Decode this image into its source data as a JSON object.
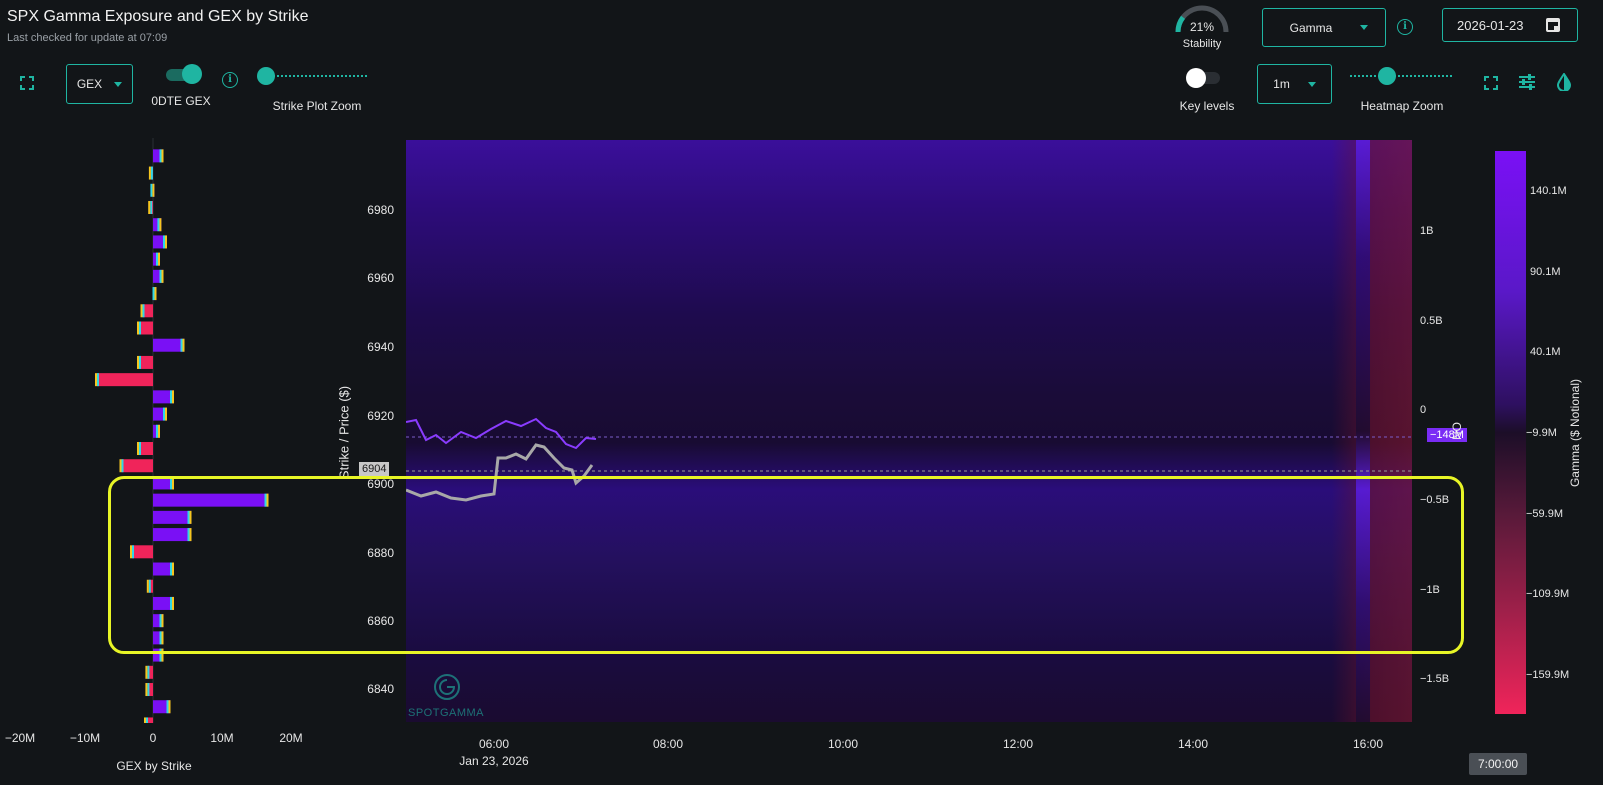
{
  "header": {
    "title": "SPX Gamma Exposure and GEX by Strike",
    "subtitle": "Last checked for update at 07:09"
  },
  "stability": {
    "value": "21%",
    "label": "Stability",
    "fraction": 0.21
  },
  "controls": {
    "metric_select": "Gamma",
    "date": "2026-01-23",
    "gex_select": "GEX",
    "odte_label": "0DTE GEX",
    "strike_zoom_label": "Strike Plot Zoom",
    "key_levels_label": "Key levels",
    "interval_select": "1m",
    "heatmap_zoom_label": "Heatmap Zoom"
  },
  "strike_chart": {
    "xlabel": "GEX by Strike",
    "xticks": [
      "−20M",
      "−10M",
      "0",
      "10M",
      "20M"
    ]
  },
  "heatmap": {
    "ylabel": "Strike / Price ($)",
    "yticks": [
      "6980",
      "6960",
      "6940",
      "6920",
      "6900",
      "6880",
      "6860",
      "6840"
    ],
    "xticks": [
      "06:00",
      "08:00",
      "10:00",
      "12:00",
      "14:00",
      "16:00"
    ],
    "xdate": "Jan 23, 2026",
    "price_tag": "6904",
    "right_ticks": [
      "1B",
      "0.5B",
      "0",
      "−0.5B",
      "−1B",
      "−1.5B"
    ],
    "right_badge": "−148M",
    "right_label": "NO",
    "watermark": "SPOTGAMMA",
    "time_tooltip": "7:00:00"
  },
  "colorbar": {
    "label": "Gamma ($ Notional)",
    "ticks": [
      "140.1M",
      "90.1M",
      "40.1M",
      "−9.9M",
      "−59.9M",
      "−109.9M",
      "−159.9M"
    ]
  },
  "colors": {
    "accent": "#1fb5a2",
    "positive": "#7a10f5",
    "negative": "#f0245a",
    "highlight": "#e8f526"
  },
  "chart_data": {
    "type": "bar",
    "title": "",
    "xlabel": "GEX by Strike",
    "ylabel": "Strike / Price ($)",
    "xlim": [
      -20,
      20
    ],
    "categories": [
      6995,
      6990,
      6985,
      6980,
      6975,
      6970,
      6965,
      6960,
      6955,
      6950,
      6945,
      6940,
      6935,
      6930,
      6925,
      6920,
      6915,
      6910,
      6905,
      6900,
      6895,
      6890,
      6885,
      6880,
      6875,
      6870,
      6865,
      6860,
      6855,
      6850,
      6845,
      6840,
      6835,
      6830
    ],
    "values": [
      1.5,
      -0.3,
      0.2,
      -0.4,
      1.2,
      2.0,
      1.0,
      1.5,
      0.5,
      -1.5,
      -2.0,
      4.5,
      -2.0,
      -8.0,
      3.0,
      2.0,
      1.0,
      -2.0,
      -4.5,
      3.0,
      16.5,
      5.5,
      5.5,
      -3.0,
      3.0,
      -0.6,
      3.0,
      1.5,
      1.5,
      1.5,
      -0.8,
      -0.8,
      2.5,
      -1.0
    ]
  }
}
